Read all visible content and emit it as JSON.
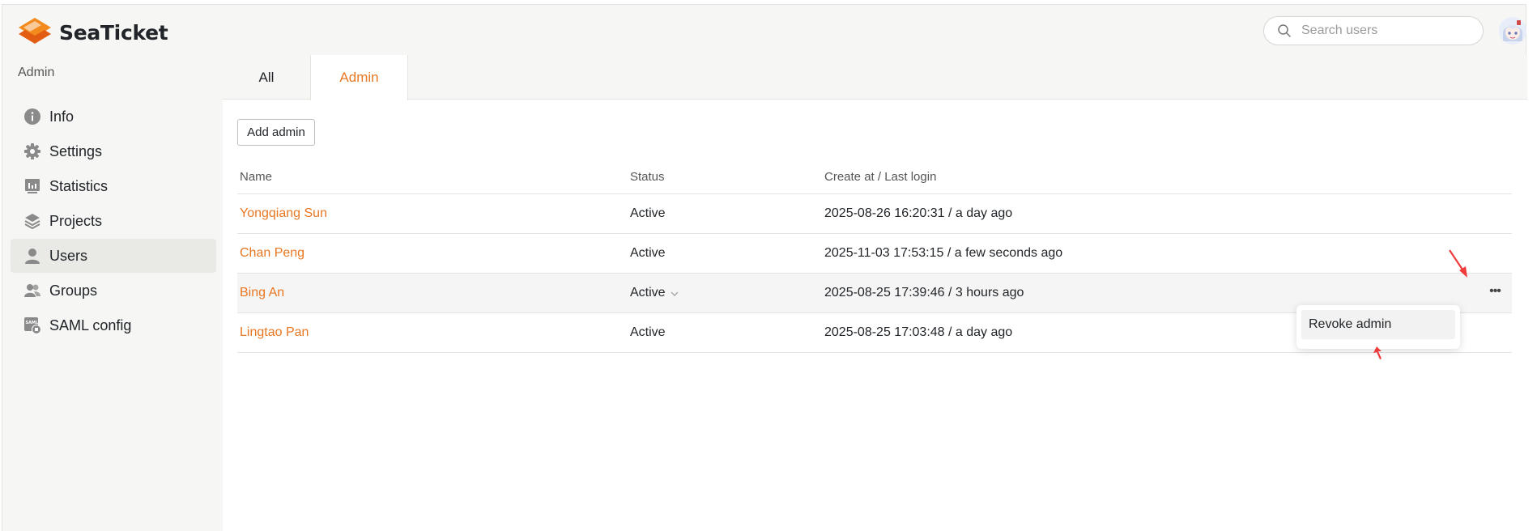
{
  "app": {
    "name": "SeaTicket",
    "brand_color": "#e87722"
  },
  "header": {
    "search_placeholder": "Search users"
  },
  "sidebar": {
    "heading": "Admin",
    "items": [
      {
        "label": "Info",
        "icon": "info-icon"
      },
      {
        "label": "Settings",
        "icon": "gear-icon"
      },
      {
        "label": "Statistics",
        "icon": "chart-icon"
      },
      {
        "label": "Projects",
        "icon": "layers-icon"
      },
      {
        "label": "Users",
        "icon": "user-icon",
        "active": true
      },
      {
        "label": "Groups",
        "icon": "group-icon"
      },
      {
        "label": "SAML config",
        "icon": "saml-icon"
      }
    ]
  },
  "tabs": {
    "all": "All",
    "admin": "Admin"
  },
  "main": {
    "add_button": "Add admin"
  },
  "table": {
    "columns": {
      "name": "Name",
      "status": "Status",
      "date": "Create at / Last login"
    },
    "rows": [
      {
        "name": "Yongqiang Sun",
        "status": "Active",
        "date": "2025-08-26 16:20:31 / a day ago"
      },
      {
        "name": "Chan Peng",
        "status": "Active",
        "date": "2025-11-03 17:53:15 / a few seconds ago"
      },
      {
        "name": "Bing An",
        "status": "Active",
        "date": "2025-08-25 17:39:46 / 3 hours ago"
      },
      {
        "name": "Lingtao Pan",
        "status": "Active",
        "date": "2025-08-25 17:03:48 / a day ago"
      }
    ]
  },
  "dropdown": {
    "revoke": "Revoke admin"
  }
}
